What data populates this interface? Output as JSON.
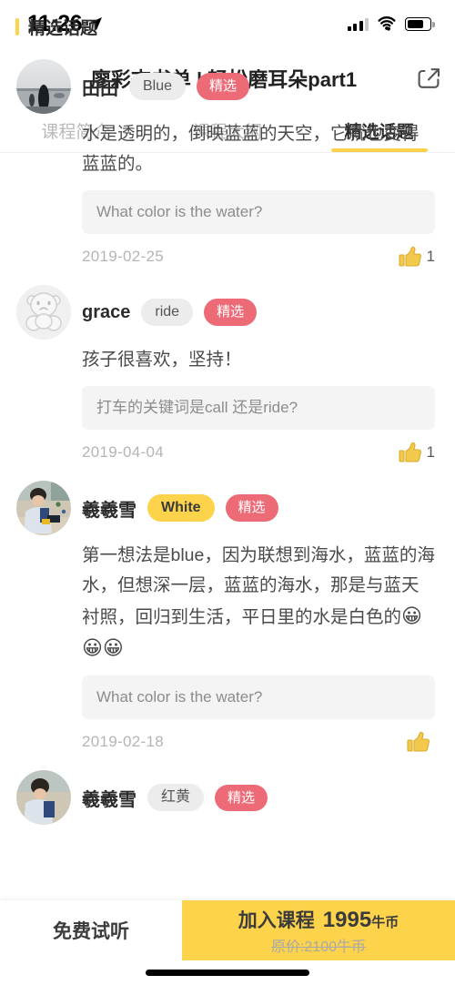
{
  "status_bar": {
    "time": "11:26",
    "location_icon": "location-arrow-icon",
    "signal_icon": "cellular-signal-icon",
    "wifi_icon": "wifi-icon",
    "battery_icon": "battery-icon"
  },
  "header": {
    "back_icon": "chevron-left-icon",
    "title": "廖彩杏书单 | 轻松磨耳朵part1",
    "share_icon": "share-icon"
  },
  "tabs": [
    {
      "label": "课程简介",
      "active": false
    },
    {
      "label": "课程大纲",
      "active": false
    },
    {
      "label": "精选话题",
      "active": true
    }
  ],
  "section": {
    "title": "精选话题",
    "accent_color": "#fcd34a"
  },
  "comments": [
    {
      "avatar_icon": "avatar-photo-landscape",
      "name": "田田",
      "tag": "Blue",
      "tag_style": "gray",
      "badge": "精选",
      "text": "水是透明的，倒映蓝蓝的天空，它就也变得蓝蓝的。",
      "question": "What color is the water?",
      "date": "2019-02-25",
      "likes": "1",
      "like_icon": "thumbs-up-icon"
    },
    {
      "avatar_icon": "avatar-cartoon-bear",
      "name": "grace",
      "tag": "ride",
      "tag_style": "gray",
      "badge": "精选",
      "text": "孩子很喜欢，坚持！",
      "question": "打车的关键词是call 还是ride?",
      "date": "2019-04-04",
      "likes": "1",
      "like_icon": "thumbs-up-icon"
    },
    {
      "avatar_icon": "avatar-photo-child",
      "name": "羲羲雪",
      "tag": "White",
      "tag_style": "yellow",
      "badge": "精选",
      "text": "第一想法是blue，因为联想到海水，蓝蓝的海水，但想深一层，蓝蓝的海水，那是与蓝天衬照，回归到生活，平日里的水是白色的",
      "emoji": "😀😀😀",
      "question": "What color is the water?",
      "date": "2019-02-18",
      "likes": "",
      "like_icon": "thumbs-up-icon"
    },
    {
      "avatar_icon": "avatar-photo-child",
      "name": "羲羲雪",
      "tag": "红黄",
      "tag_style": "gray",
      "badge": "精选",
      "text": "",
      "question": "",
      "date": "",
      "likes": "",
      "like_icon": "thumbs-up-icon"
    }
  ],
  "bottom_bar": {
    "free_trial_label": "免费试听",
    "join_label": "加入课程",
    "price": "1995",
    "price_unit": "牛币",
    "original_price": "原价:2100牛币",
    "join_bg_color": "#fcd34a"
  }
}
